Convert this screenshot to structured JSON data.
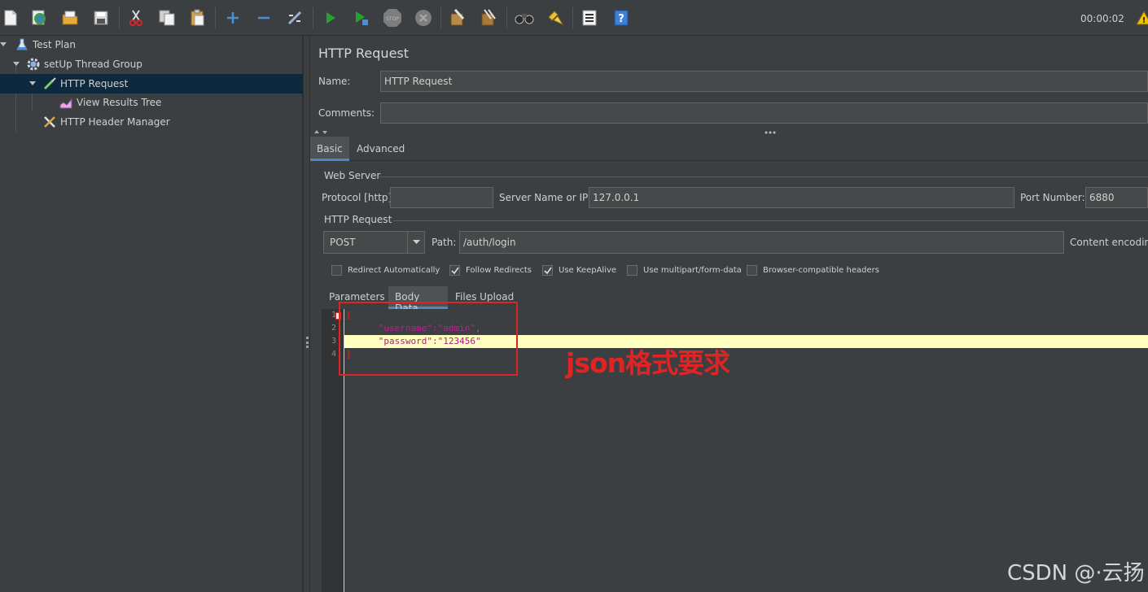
{
  "toolbar": {
    "timer": "00:00:02",
    "icons": [
      "new-icon",
      "templates-icon",
      "open-icon",
      "save-icon",
      "cut-icon",
      "copy-icon",
      "paste-icon",
      "expand-icon",
      "collapse-icon",
      "toggle-icon",
      "start-icon",
      "start-no-pauses-icon",
      "stop-icon",
      "shutdown-icon",
      "clear-icon",
      "clear-all-icon",
      "search-icon",
      "reset-search-icon",
      "function-helper-icon",
      "help-icon",
      "warning-icon"
    ]
  },
  "tree": {
    "items": [
      {
        "label": "Test Plan",
        "icon": "flask-icon"
      },
      {
        "label": "setUp Thread Group",
        "icon": "gear-icon"
      },
      {
        "label": "HTTP Request",
        "icon": "pipette-icon"
      },
      {
        "label": "View Results Tree",
        "icon": "chart-icon"
      },
      {
        "label": "HTTP Header Manager",
        "icon": "wrench-icon"
      }
    ]
  },
  "main": {
    "title": "HTTP Request",
    "name_label": "Name:",
    "name_value": "HTTP Request",
    "comments_label": "Comments:",
    "comments_value": "",
    "tabs": [
      {
        "label": "Basic"
      },
      {
        "label": "Advanced"
      }
    ],
    "web_server": {
      "title": "Web Server",
      "protocol_label": "Protocol [http]:",
      "protocol_value": "",
      "server_label": "Server Name or IP:",
      "server_value": "127.0.0.1",
      "port_label": "Port Number:",
      "port_value": "6880"
    },
    "http_request": {
      "title": "HTTP Request",
      "method": "POST",
      "path_label": "Path:",
      "path_value": "/auth/login",
      "content_encoding_label": "Content encoding"
    },
    "checkboxes": [
      {
        "label": "Redirect Automatically",
        "checked": false
      },
      {
        "label": "Follow Redirects",
        "checked": true
      },
      {
        "label": "Use KeepAlive",
        "checked": true
      },
      {
        "label": "Use multipart/form-data",
        "checked": false
      },
      {
        "label": "Browser-compatible headers",
        "checked": false
      }
    ],
    "sub_tabs": [
      {
        "label": "Parameters"
      },
      {
        "label": "Body Data"
      },
      {
        "label": "Files Upload"
      }
    ],
    "body": {
      "line_numbers": [
        "1",
        "2",
        "3",
        "4"
      ],
      "line1": "{",
      "line2_key": "\"username\"",
      "line2_colon": ":",
      "line2_val": "\"admin\"",
      "line2_comma": ",",
      "line3_key": "\"password\"",
      "line3_colon": ":",
      "line3_val": "\"123456\"",
      "line4": "}"
    }
  },
  "annotation": {
    "text": "json格式要求",
    "color": "#e02424"
  },
  "watermark": "CSDN @·云扬·"
}
